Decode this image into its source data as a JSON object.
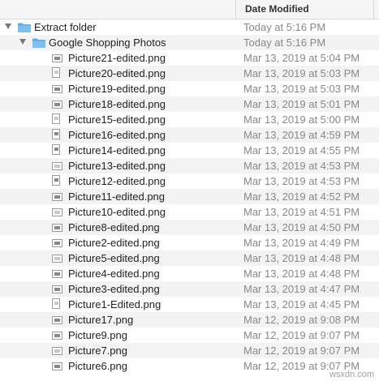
{
  "header": {
    "date_modified_label": "Date Modified"
  },
  "rows": [
    {
      "name": "Extract folder",
      "date": "Today at 5:16 PM",
      "type": "folder",
      "level": 0
    },
    {
      "name": "Google Shopping Photos",
      "date": "Today at 5:16 PM",
      "type": "folder",
      "level": 1
    },
    {
      "name": "Picture21-edited.png",
      "date": "Mar 13, 2019 at 5:04 PM",
      "type": "file",
      "level": 2,
      "icon": "image-file-icon"
    },
    {
      "name": "Picture20-edited.png",
      "date": "Mar 13, 2019 at 5:03 PM",
      "type": "file",
      "level": 2,
      "icon": "image-file-icon"
    },
    {
      "name": "Picture19-edited.png",
      "date": "Mar 13, 2019 at 5:03 PM",
      "type": "file",
      "level": 2,
      "icon": "image-file-icon"
    },
    {
      "name": "Picture18-edited.png",
      "date": "Mar 13, 2019 at 5:01 PM",
      "type": "file",
      "level": 2,
      "icon": "image-file-icon"
    },
    {
      "name": "Picture15-edited.png",
      "date": "Mar 13, 2019 at 5:00 PM",
      "type": "file",
      "level": 2,
      "icon": "image-file-icon"
    },
    {
      "name": "Picture16-edited.png",
      "date": "Mar 13, 2019 at 4:59 PM",
      "type": "file",
      "level": 2,
      "icon": "image-file-icon"
    },
    {
      "name": "Picture14-edited.png",
      "date": "Mar 13, 2019 at 4:55 PM",
      "type": "file",
      "level": 2,
      "icon": "image-file-icon"
    },
    {
      "name": "Picture13-edited.png",
      "date": "Mar 13, 2019 at 4:53 PM",
      "type": "file",
      "level": 2,
      "icon": "image-file-icon"
    },
    {
      "name": "Picture12-edited.png",
      "date": "Mar 13, 2019 at 4:53 PM",
      "type": "file",
      "level": 2,
      "icon": "image-file-icon"
    },
    {
      "name": "Picture11-edited.png",
      "date": "Mar 13, 2019 at 4:52 PM",
      "type": "file",
      "level": 2,
      "icon": "image-file-icon"
    },
    {
      "name": "Picture10-edited.png",
      "date": "Mar 13, 2019 at 4:51 PM",
      "type": "file",
      "level": 2,
      "icon": "image-file-icon"
    },
    {
      "name": "Picture8-edited.png",
      "date": "Mar 13, 2019 at 4:50 PM",
      "type": "file",
      "level": 2,
      "icon": "image-file-icon"
    },
    {
      "name": "Picture2-edited.png",
      "date": "Mar 13, 2019 at 4:49 PM",
      "type": "file",
      "level": 2,
      "icon": "image-file-icon"
    },
    {
      "name": "Picture5-edited.png",
      "date": "Mar 13, 2019 at 4:48 PM",
      "type": "file",
      "level": 2,
      "icon": "image-file-icon"
    },
    {
      "name": "Picture4-edited.png",
      "date": "Mar 13, 2019 at 4:48 PM",
      "type": "file",
      "level": 2,
      "icon": "image-file-icon"
    },
    {
      "name": "Picture3-edited.png",
      "date": "Mar 13, 2019 at 4:47 PM",
      "type": "file",
      "level": 2,
      "icon": "image-file-icon"
    },
    {
      "name": "Picture1-Edited.png",
      "date": "Mar 13, 2019 at 4:45 PM",
      "type": "file",
      "level": 2,
      "icon": "image-file-icon"
    },
    {
      "name": "Picture17.png",
      "date": "Mar 12, 2019 at 9:08 PM",
      "type": "file",
      "level": 2,
      "icon": "image-file-icon"
    },
    {
      "name": "Picture9.png",
      "date": "Mar 12, 2019 at 9:07 PM",
      "type": "file",
      "level": 2,
      "icon": "image-file-icon"
    },
    {
      "name": "Picture7.png",
      "date": "Mar 12, 2019 at 9:07 PM",
      "type": "file",
      "level": 2,
      "icon": "image-file-icon"
    },
    {
      "name": "Picture6.png",
      "date": "Mar 12, 2019 at 9:07 PM",
      "type": "file",
      "level": 2,
      "icon": "image-file-icon"
    }
  ],
  "watermark": "wsxdn.com",
  "colors": {
    "folder_blue": "#5aaee8",
    "folder_tab": "#7cc0ef",
    "date_gray": "#888888"
  }
}
